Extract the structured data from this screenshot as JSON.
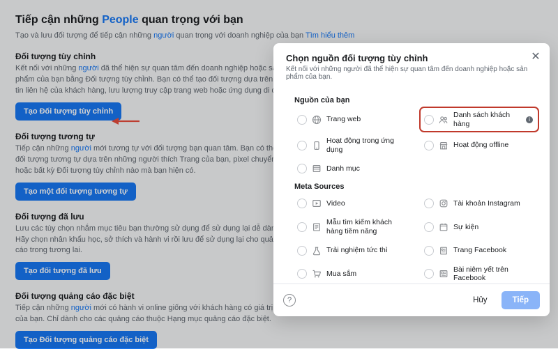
{
  "hero": {
    "title_before": "Tiếp cận những ",
    "title_link": "People",
    "title_after": " quan trọng với bạn",
    "sub_before": "Tạo và lưu đối tượng để tiếp cận những ",
    "sub_link": "người",
    "sub_mid": " quan trọng với doanh nghiệp của bạn ",
    "sub_learn": "Tìm hiểu thêm"
  },
  "sections": [
    {
      "title": "Đối tượng tùy chỉnh",
      "desc_parts": [
        "Kết nối với những ",
        "người",
        " đã thể hiện sự quan tâm đến doanh nghiệp hoặc sản phẩm của bạn bằng Đối tượng tùy chỉnh. Bạn có thể tạo đối tượng dựa trên thông tin liên hệ của khách hàng, lưu lượng truy cập trang web hoặc ứng dụng di động."
      ],
      "button": "Tạo Đối tượng tùy chỉnh"
    },
    {
      "title": "Đối tượng tương tự",
      "desc_parts": [
        "Tiếp cận những ",
        "người",
        " mới tương tự với đối tượng bạn quan tâm. Bạn có thể tạo đối tượng tương tự dựa trên những người thích Trang của bạn, pixel chuyển đổi hoặc bất kỳ Đối tượng tùy chỉnh nào mà bạn hiện có."
      ],
      "button": "Tạo một đối tượng tương tự"
    },
    {
      "title": "Đối tượng đã lưu",
      "desc_parts": [
        "Lưu các tùy chọn nhắm mục tiêu bạn thường sử dụng để sử dụng lại dễ dàng. Hãy chọn nhân khẩu học, sở thích và hành vi rồi lưu để sử dụng lại cho quảng cáo trong tương lai."
      ],
      "button": "Tạo đối tượng đã lưu"
    },
    {
      "title": "Đối tượng quảng cáo đặc biệt",
      "desc_parts": [
        "Tiếp cận những ",
        "người",
        " mới có hành vi online giống với khách hàng có giá trị nhất của bạn. Chỉ dành cho các quảng cáo thuộc Hạng mục quảng cáo đặc biệt."
      ],
      "button": "Tạo Đối tượng quảng cáo đặc biệt"
    }
  ],
  "modal": {
    "title": "Chọn nguồn đối tượng tùy chỉnh",
    "subtitle": "Kết nối với những người đã thể hiện sự quan tâm đến doanh nghiệp hoặc sản phẩm của bạn.",
    "groups": [
      {
        "title": "Nguồn của bạn",
        "items": [
          {
            "icon": "globe",
            "label": "Trang web"
          },
          {
            "icon": "users",
            "label": "Danh sách khách hàng",
            "highlight": true,
            "info": true
          },
          {
            "icon": "phone",
            "label": "Hoạt động trong ứng dụng"
          },
          {
            "icon": "store",
            "label": "Hoạt động offline"
          },
          {
            "icon": "catalog",
            "label": "Danh mục"
          }
        ]
      },
      {
        "title": "Meta Sources",
        "items": [
          {
            "icon": "play",
            "label": "Video"
          },
          {
            "icon": "instagram",
            "label": "Tài khoản Instagram"
          },
          {
            "icon": "form",
            "label": "Mẫu tìm kiếm khách hàng tiềm năng"
          },
          {
            "icon": "calendar",
            "label": "Sự kiện"
          },
          {
            "icon": "flask",
            "label": "Trải nghiệm tức thì"
          },
          {
            "icon": "page",
            "label": "Trang Facebook"
          },
          {
            "icon": "cart",
            "label": "Mua sắm"
          },
          {
            "icon": "listing",
            "label": "Bài niêm yết trên Facebook"
          }
        ]
      }
    ],
    "cancel": "Hủy",
    "next": "Tiếp"
  }
}
